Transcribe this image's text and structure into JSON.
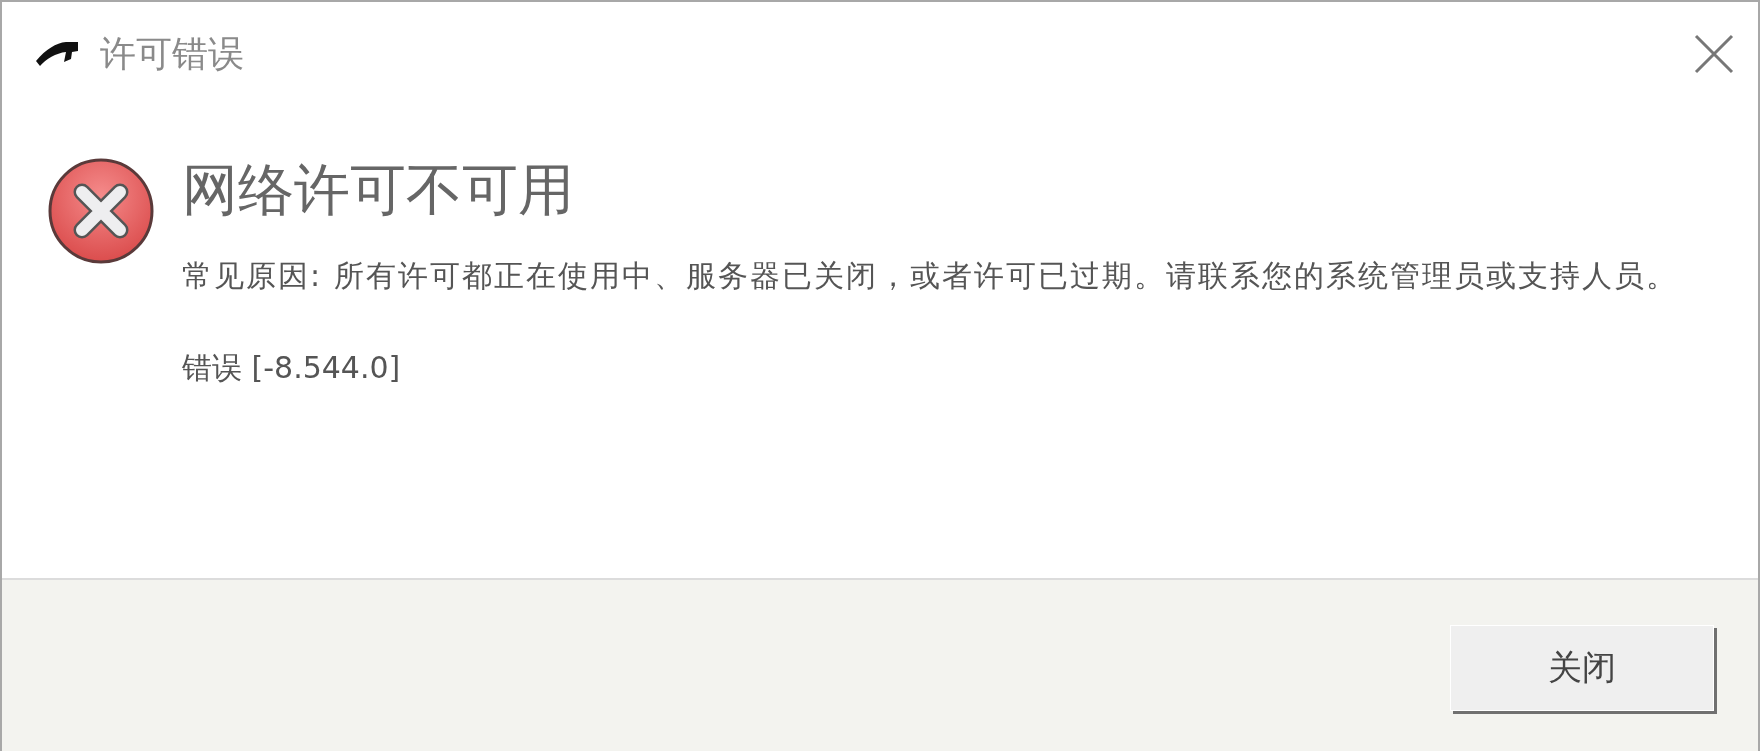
{
  "window": {
    "title": "许可错误"
  },
  "heading": "网络许可不可用",
  "message": "常见原因: 所有许可都正在使用中、服务器已关闭，或者许可已过期。请联系您的系统管理员或支持人员。",
  "error_code": "错误 [-8.544.0]",
  "buttons": [
    {
      "label": "关闭"
    }
  ]
}
